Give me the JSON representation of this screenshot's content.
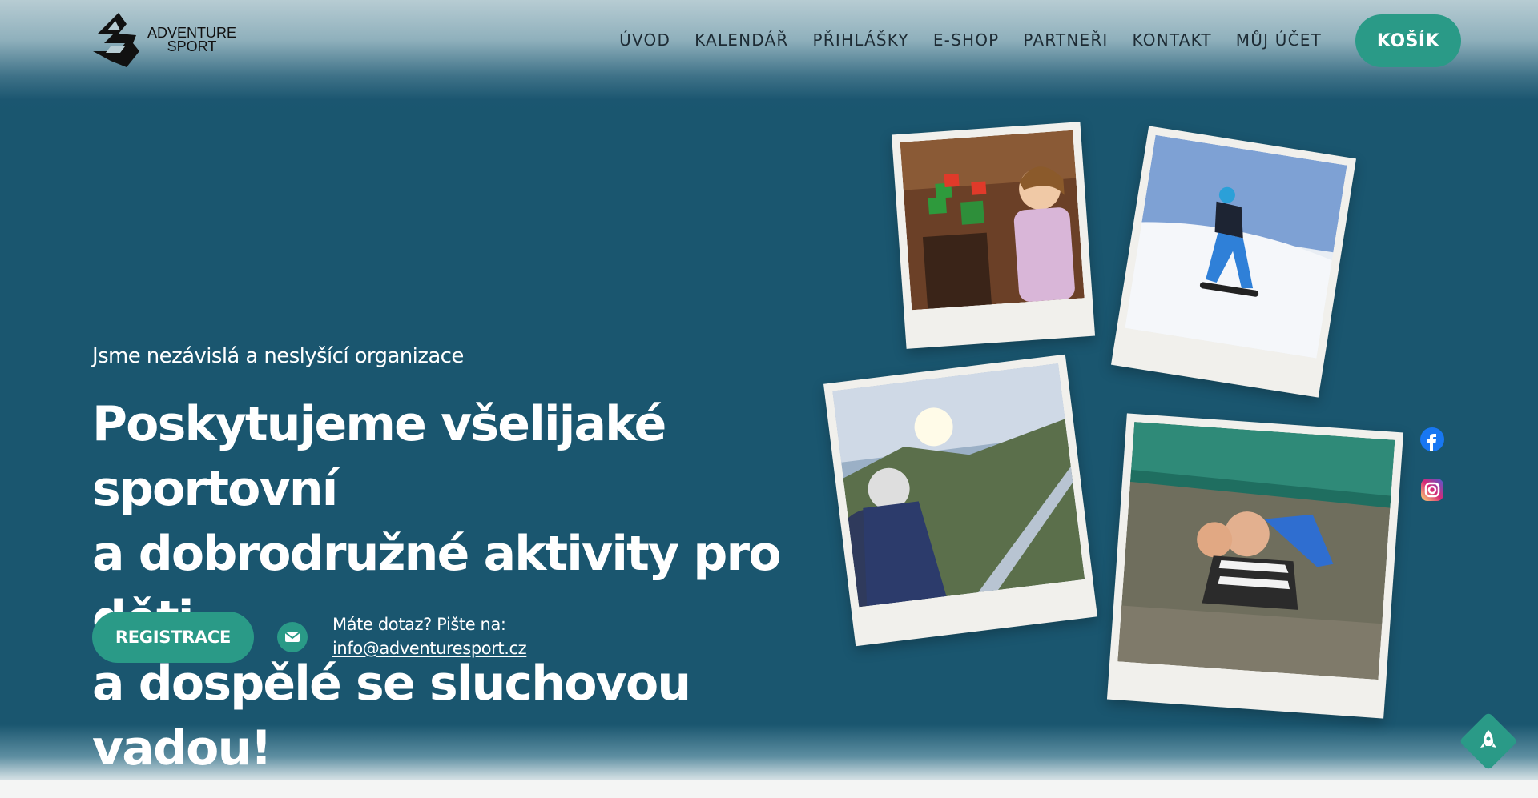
{
  "brand": {
    "line1": "ADVENTURE",
    "line2": "SPORT",
    "logo_icon": "adventure-sport-logo"
  },
  "nav": {
    "items": [
      "ÚVOD",
      "KALENDÁŘ",
      "PŘIHLÁŠKY",
      "E-SHOP",
      "PARTNEŘI",
      "KONTAKT",
      "MŮJ ÚČET"
    ]
  },
  "cart_label": "KOŠÍK",
  "hero": {
    "tagline": "Jsme nezávislá a neslyšící organizace",
    "headline_lines": [
      "Poskytujeme všelijaké sportovní",
      "a dobrodružné aktivity pro děti",
      "a dospělé se sluchovou vadou!"
    ],
    "register_label": "REGISTRACE",
    "contact_label": "Máte dotaz? Pište na:",
    "contact_email": "info@adventuresport.cz"
  },
  "social": {
    "items": [
      "facebook-icon",
      "instagram-icon"
    ]
  },
  "colors": {
    "hero_bg": "#1a566f",
    "accent": "#2a9a87",
    "text": "#ffffff",
    "nav_text": "#1d2b34"
  }
}
